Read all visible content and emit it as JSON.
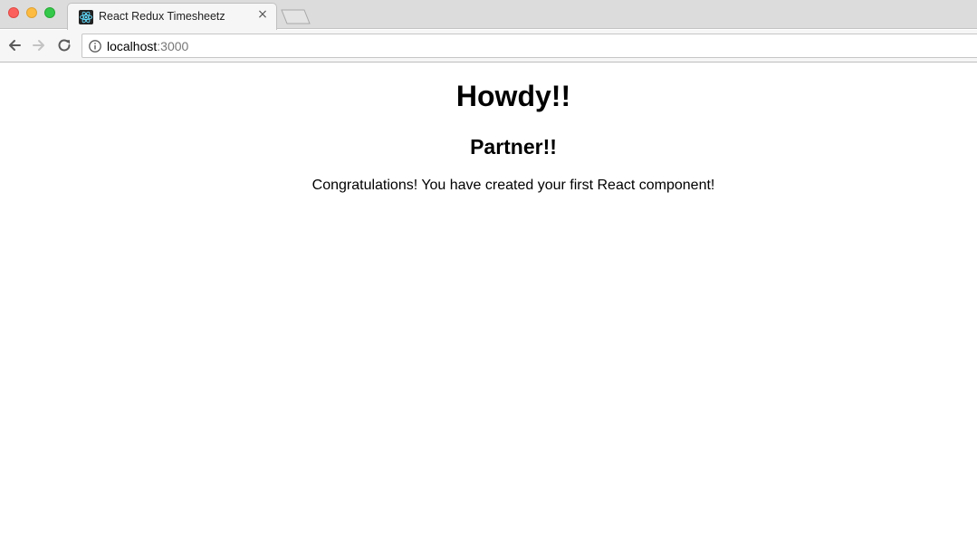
{
  "browser": {
    "tab": {
      "title": "React Redux Timesheetz",
      "favicon": "react-icon",
      "close_label": "×"
    },
    "toolbar": {
      "back_icon": "arrow-left-icon",
      "forward_icon": "arrow-right-icon",
      "reload_icon": "reload-icon",
      "info_icon": "info-icon",
      "url_host": "localhost",
      "url_port": ":3000"
    },
    "colors": {
      "close": "#fc605c",
      "minimize": "#fdbc40",
      "maximize": "#34c84a",
      "react_accent": "#61dafb"
    }
  },
  "page": {
    "heading": "Howdy!!",
    "subheading": "Partner!!",
    "message": "Congratulations! You have created your first React component!"
  }
}
